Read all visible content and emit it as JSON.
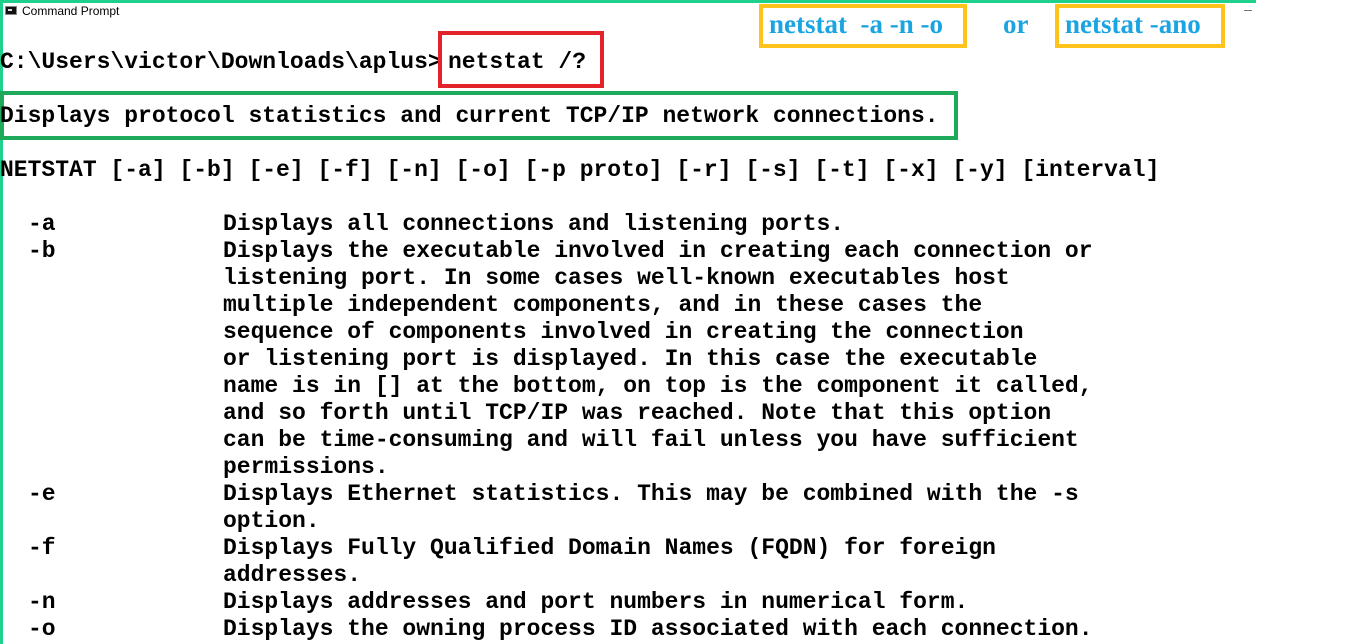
{
  "window": {
    "title": "Command Prompt"
  },
  "annotations": {
    "option_split": "netstat  -a -n -o",
    "connector": "or",
    "option_combined": "netstat -ano"
  },
  "terminal": {
    "prompt": "C:\\Users\\victor\\Downloads\\aplus>",
    "command": "netstat /?",
    "description": "Displays protocol statistics and current TCP/IP network connections.",
    "usage": "NETSTAT [-a] [-b] [-e] [-f] [-n] [-o] [-p proto] [-r] [-s] [-t] [-x] [-y] [interval]",
    "options": [
      {
        "flag": "-a",
        "lines": [
          "Displays all connections and listening ports."
        ]
      },
      {
        "flag": "-b",
        "lines": [
          "Displays the executable involved in creating each connection or",
          "listening port. In some cases well-known executables host",
          "multiple independent components, and in these cases the",
          "sequence of components involved in creating the connection",
          "or listening port is displayed. In this case the executable",
          "name is in [] at the bottom, on top is the component it called,",
          "and so forth until TCP/IP was reached. Note that this option",
          "can be time-consuming and will fail unless you have sufficient",
          "permissions."
        ]
      },
      {
        "flag": "-e",
        "lines": [
          "Displays Ethernet statistics. This may be combined with the -s",
          "option."
        ]
      },
      {
        "flag": "-f",
        "lines": [
          "Displays Fully Qualified Domain Names (FQDN) for foreign",
          "addresses."
        ]
      },
      {
        "flag": "-n",
        "lines": [
          "Displays addresses and port numbers in numerical form."
        ]
      },
      {
        "flag": "-o",
        "lines": [
          "Displays the owning process ID associated with each connection."
        ]
      }
    ]
  },
  "colors": {
    "frame": "#1fd08d",
    "highlight_yellow": "#ffc31c",
    "highlight_red": "#e2232a",
    "highlight_green": "#1fa95a",
    "annotation_text": "#1aa4e1"
  }
}
